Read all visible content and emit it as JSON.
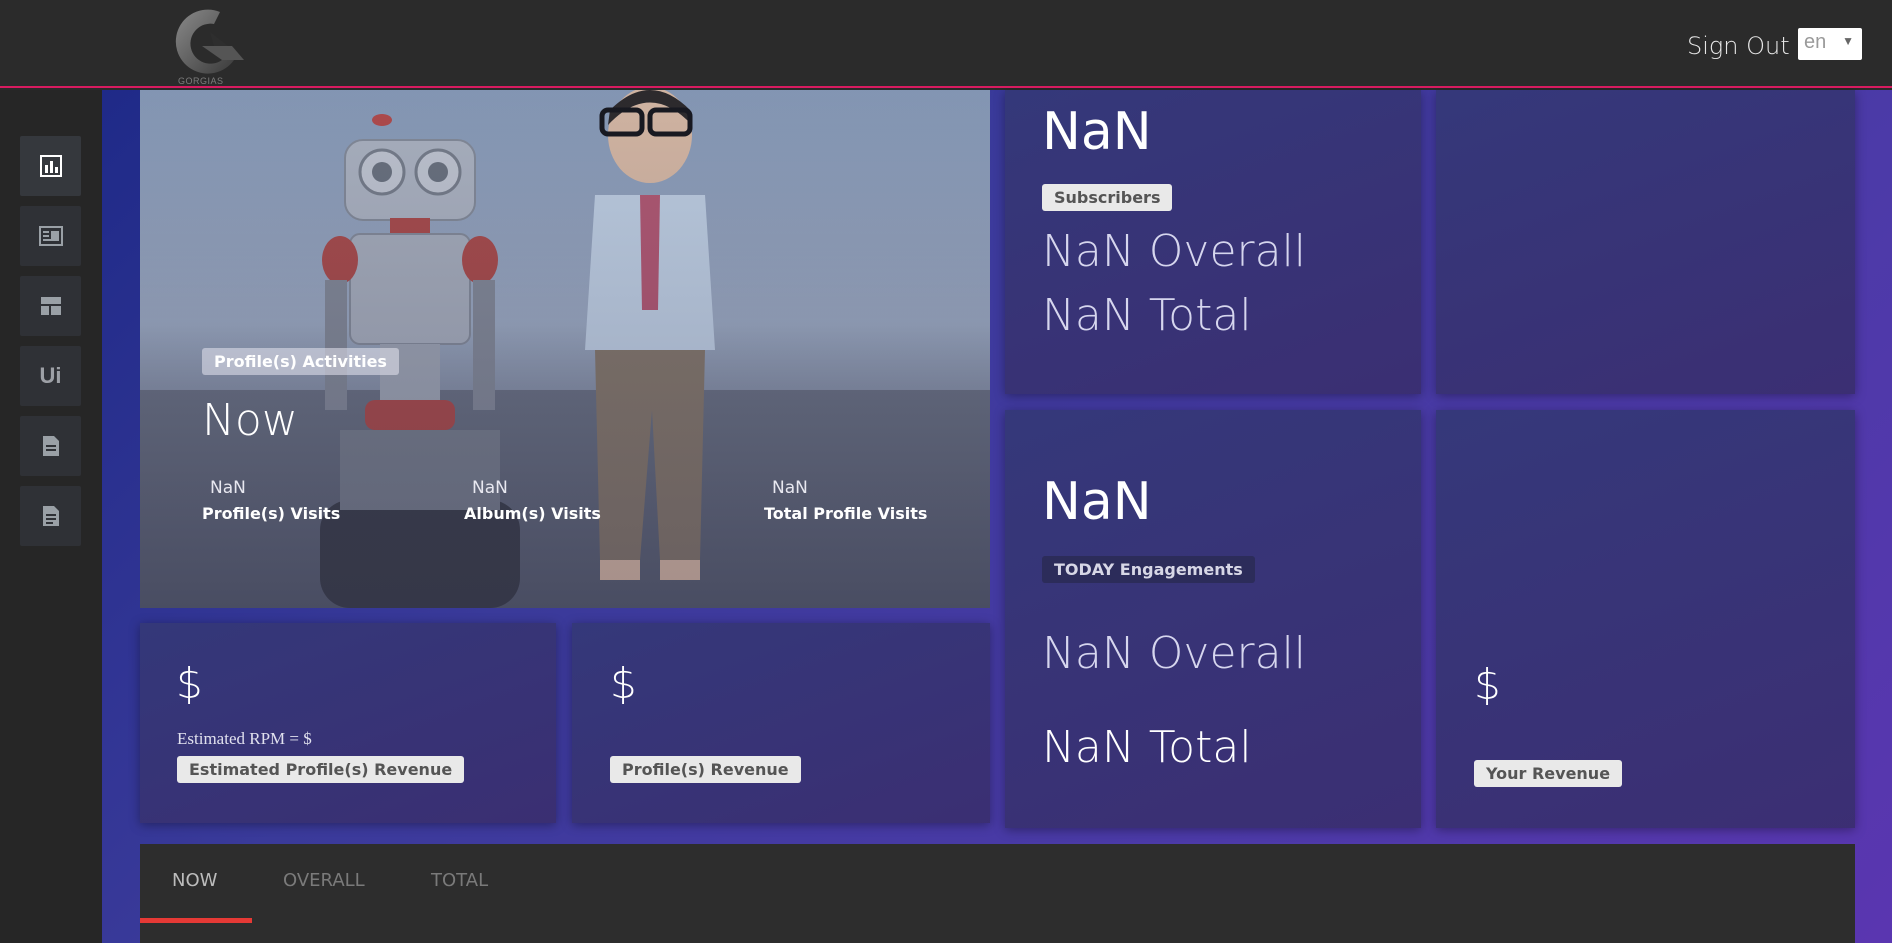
{
  "header": {
    "logo_text": "GORGIAS",
    "signout_label": "Sign Out",
    "language": {
      "selected": "en"
    }
  },
  "sidebar": {
    "items": [
      {
        "icon": "bar-chart-icon"
      },
      {
        "icon": "newspaper-icon"
      },
      {
        "icon": "layout-icon"
      },
      {
        "icon": "ui-text-icon",
        "label": "Ui"
      },
      {
        "icon": "document-icon"
      },
      {
        "icon": "document-list-icon"
      }
    ]
  },
  "hero": {
    "badge": "Profile(s) Activities",
    "heading": "Now",
    "stats": [
      {
        "value": "NaN",
        "label": "Profile(s) Visits"
      },
      {
        "value": "NaN",
        "label": "Album(s) Visits"
      },
      {
        "value": "NaN",
        "label": "Total Profile Visits"
      }
    ]
  },
  "subscribers_card": {
    "value": "NaN",
    "badge": "Subscribers",
    "overall": "NaN Overall",
    "total": "NaN Total"
  },
  "engagements_card": {
    "value": "NaN",
    "badge": "TODAY Engagements",
    "overall": "NaN Overall",
    "total": "NaN Total"
  },
  "estimated_revenue_card": {
    "currency": "$",
    "rpm": "Estimated RPM = $",
    "badge": "Estimated Profile(s) Revenue"
  },
  "profile_revenue_card": {
    "currency": "$",
    "badge": "Profile(s) Revenue"
  },
  "your_revenue_card": {
    "currency": "$",
    "badge": "Your Revenue"
  },
  "tabs": {
    "items": [
      "NOW",
      "OVERALL",
      "TOTAL"
    ],
    "active": "NOW"
  },
  "colors": {
    "accent": "#d81b60",
    "tab_underline": "#e53935"
  }
}
